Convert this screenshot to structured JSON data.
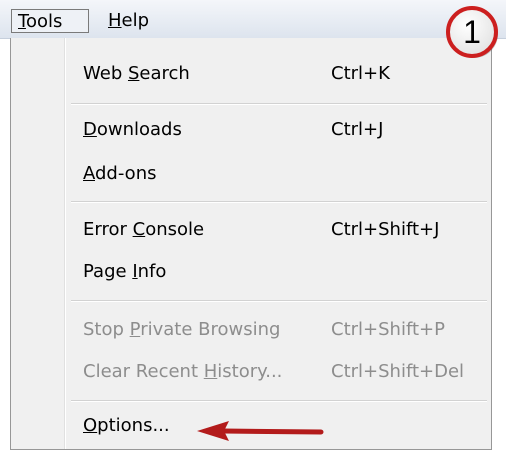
{
  "menubar": {
    "tools": {
      "before": "",
      "mnemonic": "T",
      "after": "ools"
    },
    "help": {
      "before": "",
      "mnemonic": "H",
      "after": "elp"
    }
  },
  "menu": {
    "web_search": {
      "before": "Web ",
      "mnemonic": "S",
      "after": "earch",
      "shortcut": "Ctrl+K"
    },
    "downloads": {
      "before": "",
      "mnemonic": "D",
      "after": "ownloads",
      "shortcut": "Ctrl+J"
    },
    "addons": {
      "before": "",
      "mnemonic": "A",
      "after": "dd-ons",
      "shortcut": ""
    },
    "error_console": {
      "before": "Error ",
      "mnemonic": "C",
      "after": "onsole",
      "shortcut": "Ctrl+Shift+J"
    },
    "page_info": {
      "before": "Page ",
      "mnemonic": "I",
      "after": "nfo",
      "shortcut": ""
    },
    "stop_private": {
      "before": "Stop ",
      "mnemonic": "P",
      "after": "rivate Browsing",
      "shortcut": "Ctrl+Shift+P",
      "disabled": true
    },
    "clear_history": {
      "before": "Clear Recent ",
      "mnemonic": "H",
      "after": "istory...",
      "shortcut": "Ctrl+Shift+Del",
      "disabled": true
    },
    "options": {
      "before": "",
      "mnemonic": "O",
      "after": "ptions...",
      "shortcut": ""
    }
  },
  "badge": {
    "number": "1",
    "ring_color": "#cc1f1f"
  },
  "arrow": {
    "color": "#b31b1b",
    "icon": "left-arrow-icon"
  }
}
